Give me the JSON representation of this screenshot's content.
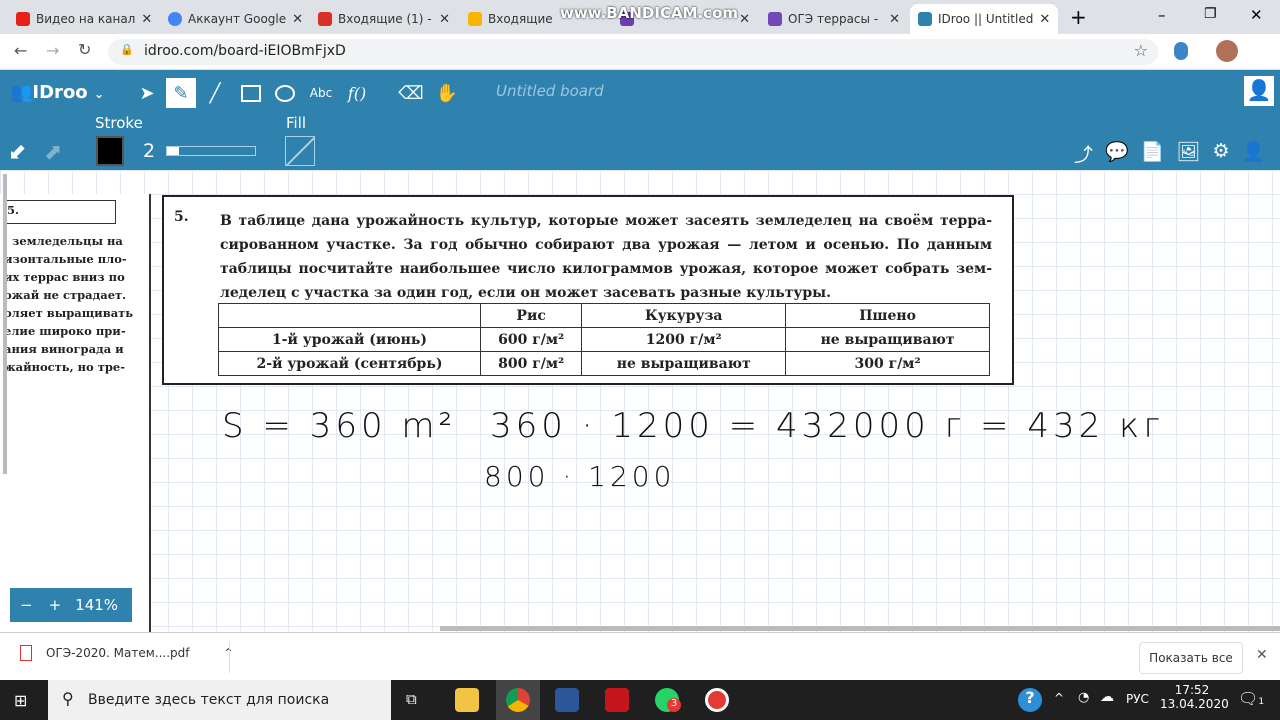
{
  "browser": {
    "tabs": [
      {
        "label": "Видео на канал",
        "color": "#e62117"
      },
      {
        "label": "Аккаунт Google",
        "color": "#4285f4"
      },
      {
        "label": "Входящие (1) -",
        "color": "#d93025"
      },
      {
        "label": "Входящие",
        "color": "#f7b500"
      },
      {
        "label": "",
        "color": "#6a3fb0"
      },
      {
        "label": "ОГЭ террасы -",
        "color": "#7248b9"
      },
      {
        "label": "IDroo || Untitled",
        "color": "#2f82ad"
      }
    ],
    "url": "idroo.com/board-iEIOBmFjxD",
    "watermark": "www.BANDICAM.com"
  },
  "app": {
    "logo": "IDroo",
    "board_title": "Untitled board",
    "stroke_label": "Stroke",
    "stroke_width": "2",
    "stroke_color": "#000000",
    "fill_label": "Fill",
    "tools": [
      "select",
      "pen",
      "line",
      "rectangle",
      "ellipse",
      "text",
      "formula",
      "eraser",
      "hand"
    ],
    "text_tool": "Abc",
    "formula_tool": "f()",
    "zoom": "141%",
    "zoom_minus": "−",
    "zoom_plus": "+"
  },
  "left_page": {
    "number": "5.",
    "lines": [
      ", земледельцы на",
      "изонтальные пло-",
      "их террас вниз по",
      "ожай не страдает.",
      "оляет выращивать",
      "елие широко при-",
      "ания винограда и",
      "жайность, но тре-"
    ]
  },
  "task": {
    "number": "5.",
    "text": "В таблице дана урожайность культур, которые может засеять земледелец на своём терра­сированном участке. За год обычно собирают два урожая — летом и осенью. По данным таблицы посчитайте наибольшее число килограммов урожая, которое может собрать зем­леделец с участка за один год, если он может засевать разные культуры.",
    "table": {
      "headers": [
        "",
        "Рис",
        "Кукуруза",
        "Пшено"
      ],
      "rows": [
        [
          "1-й урожай (июнь)",
          "600 г/м²",
          "1200 г/м²",
          "не выращивают"
        ],
        [
          "2-й урожай (сентябрь)",
          "800 г/м²",
          "не выращивают",
          "300 г/м²"
        ]
      ]
    }
  },
  "handwriting": {
    "line1": "S = 360 m²",
    "line2": "360 · 1200 = 432000 г = 432 кг",
    "line3": "800 · 1200"
  },
  "download": {
    "file": "ОГЭ-2020. Матем....pdf",
    "show_all": "Показать все"
  },
  "taskbar": {
    "search_placeholder": "Введите здесь текст для поиска",
    "lang": "РУС",
    "time": "17:52",
    "date": "13.04.2020",
    "whatsapp_badge": "3",
    "notif_badge": "1"
  }
}
